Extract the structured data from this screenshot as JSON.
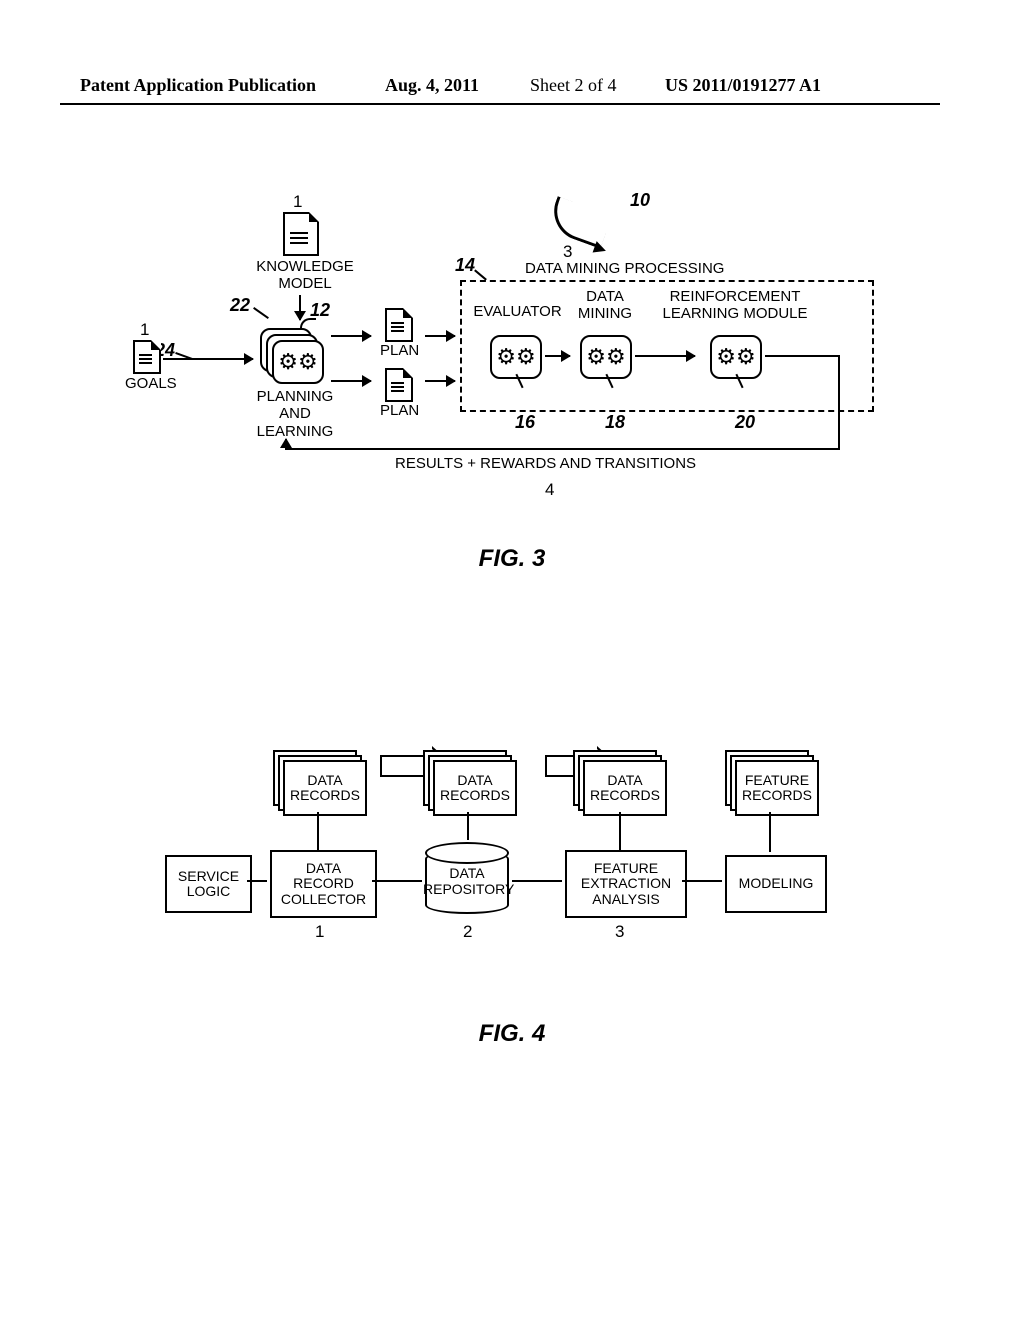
{
  "header": {
    "left": "Patent Application Publication",
    "date": "Aug. 4, 2011",
    "sheet": "Sheet 2 of 4",
    "pubno": "US 2011/0191277 A1"
  },
  "fig3": {
    "label": "FIG. 3",
    "ref_main": "10",
    "knowledge_model_num": "1",
    "knowledge_model": "KNOWLEDGE\nMODEL",
    "goals_num": "1",
    "goals": "GOALS",
    "ref_22": "22",
    "ref_24": "24",
    "ref_12": "12",
    "planning_learning": "PLANNING\nAND\nLEARNING",
    "plan1": "PLAN",
    "plan2": "PLAN",
    "ref_14": "14",
    "data_mining_processing_num": "3",
    "data_mining_processing": "DATA MINING PROCESSING",
    "evaluator": "EVALUATOR",
    "data_mining": "DATA\nMINING",
    "reinforcement": "REINFORCEMENT\nLEARNING MODULE",
    "ref_16": "16",
    "ref_18": "18",
    "ref_20": "20",
    "results": "RESULTS + REWARDS AND TRANSITIONS",
    "results_num": "4"
  },
  "fig4": {
    "label": "FIG. 4",
    "service_logic": "SERVICE\nLOGIC",
    "data_record_collector": "DATA\nRECORD\nCOLLECTOR",
    "data_records1": "DATA\nRECORDS",
    "data_records2": "DATA\nRECORDS",
    "data_records3": "DATA\nRECORDS",
    "data_repository": "DATA\nREPOSITORY",
    "feature_extraction": "FEATURE\nEXTRACTION\nANALYSIS",
    "feature_records": "FEATURE\nRECORDS",
    "modeling": "MODELING",
    "n1": "1",
    "n2": "2",
    "n3": "3"
  }
}
